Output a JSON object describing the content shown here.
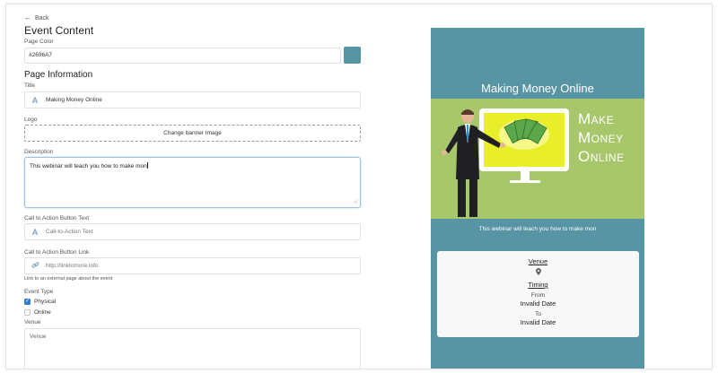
{
  "nav": {
    "back_label": "Back"
  },
  "page_title": "Event Content",
  "page_color": {
    "label": "Page Color",
    "value": "#2696A7",
    "swatch": "#5794a4"
  },
  "page_info": {
    "heading": "Page Information",
    "title_label": "Title",
    "title_value": "Making Money Online",
    "logo_label": "Logo",
    "logo_button": "Change banner Image",
    "description_label": "Description",
    "description_value": "This webinar will teach you how to make mon",
    "cta_text_label": "Call to Action Button Text",
    "cta_text_placeholder": "Call-to-Action Text",
    "cta_link_label": "Call to Action Button Link",
    "cta_link_placeholder": "http://linktomore.info",
    "cta_link_hint": "Link to an external page about the event",
    "event_type_label": "Event Type",
    "event_types": [
      {
        "label": "Physical",
        "checked": true
      },
      {
        "label": "Online",
        "checked": false
      }
    ],
    "venue_label": "Venue",
    "venue_placeholder": "Venue"
  },
  "preview": {
    "background": "#5794a4",
    "title": "Making Money Online",
    "banner_text": [
      "Make",
      "Money",
      "Online"
    ],
    "description": "This webinar will teach you how to make mon",
    "card": {
      "venue_label": "Venue",
      "timing_label": "Timing",
      "from_label": "From",
      "from_value": "Invalid Date",
      "to_label": "To",
      "to_value": "Invalid Date"
    }
  }
}
